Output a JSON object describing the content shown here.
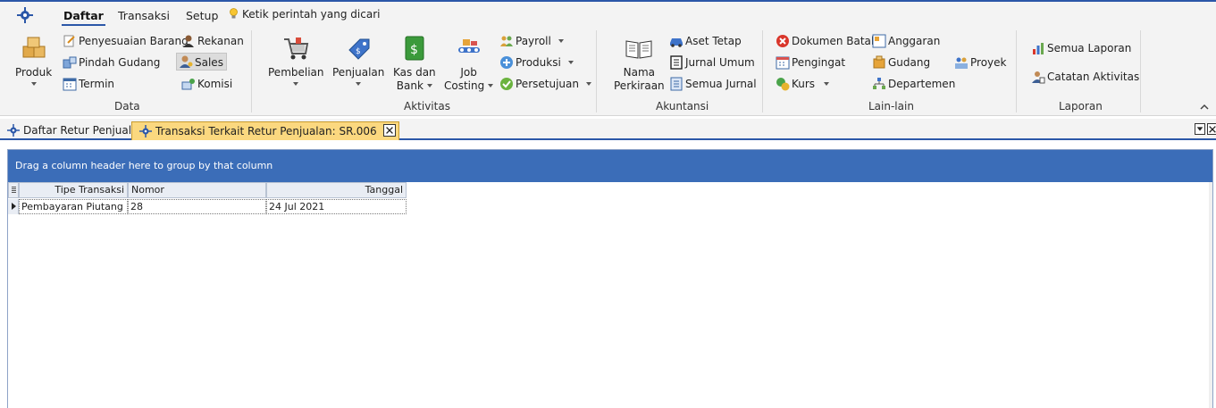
{
  "menu": {
    "tabs": [
      {
        "label": "Daftar",
        "active": true
      },
      {
        "label": "Transaksi",
        "active": false
      },
      {
        "label": "Setup",
        "active": false
      }
    ],
    "tell_me": "Ketik perintah yang dicari"
  },
  "ribbon": {
    "data": {
      "label": "Data",
      "produk": "Produk",
      "penyesuaian_barang": "Penyesuaian Barang",
      "pindah_gudang": "Pindah Gudang",
      "termin": "Termin",
      "rekanan": "Rekanan",
      "sales": "Sales",
      "komisi": "Komisi"
    },
    "aktivitas": {
      "label": "Aktivitas",
      "pembelian": "Pembelian",
      "penjualan": "Penjualan",
      "kas_line1": "Kas dan",
      "kas_line2": "Bank",
      "job_line1": "Job",
      "job_line2": "Costing",
      "payroll": "Payroll",
      "produksi": "Produksi",
      "persetujuan": "Persetujuan"
    },
    "akuntansi": {
      "label": "Akuntansi",
      "nama_line1": "Nama",
      "nama_line2": "Perkiraan",
      "aset_tetap": "Aset Tetap",
      "jurnal_umum": "Jurnal Umum",
      "semua_jurnal": "Semua Jurnal"
    },
    "lain": {
      "label": "Lain-lain",
      "dokumen_batal": "Dokumen Batal",
      "pengingat": "Pengingat",
      "kurs": "Kurs",
      "anggaran": "Anggaran",
      "gudang": "Gudang",
      "departemen": "Departemen",
      "proyek": "Proyek"
    },
    "laporan": {
      "label": "Laporan",
      "semua_laporan": "Semua Laporan",
      "catatan_aktivitas": "Catatan Aktivitas"
    }
  },
  "doc_tabs": [
    {
      "label": "Daftar Retur Penjualan",
      "active": false
    },
    {
      "label": "Transaksi Terkait Retur Penjualan: SR.006",
      "active": true
    }
  ],
  "grid": {
    "group_hint": "Drag a column header here to group by that column",
    "columns": [
      "Tipe Transaksi",
      "Nomor",
      "Tanggal"
    ],
    "rows": [
      {
        "tipe": "Pembayaran Piutang",
        "nomor": "28",
        "tanggal": "24 Jul 2021"
      }
    ]
  },
  "colors": {
    "accent": "#2b57a8",
    "group_panel": "#3b6db8",
    "active_tab": "#fbd87f"
  }
}
